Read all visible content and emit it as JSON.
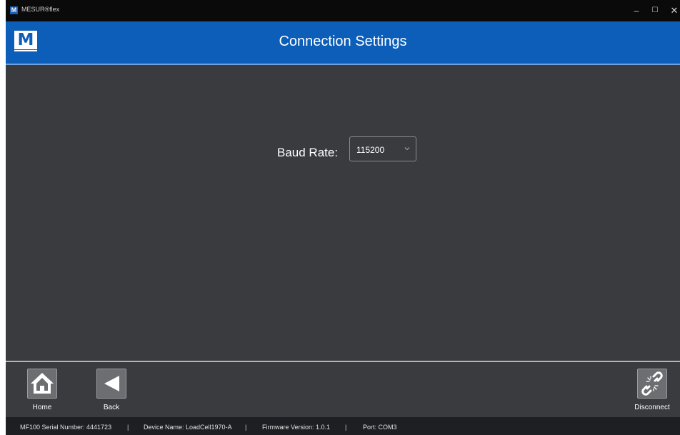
{
  "window": {
    "app_title": "MESUR®flex",
    "app_icon_letter": "M",
    "controls": {
      "minimize": "–",
      "maximize": "☐",
      "close": "✕"
    }
  },
  "header": {
    "logo_letter": "M",
    "title": "Connection Settings",
    "background_color": "#0c5eb9"
  },
  "settings": {
    "baud_rate_label": "Baud Rate:",
    "baud_rate_value": "115200"
  },
  "toolbar": {
    "home_label": "Home",
    "home_icon": "home-icon",
    "back_label": "Back",
    "back_icon": "back-arrow-icon",
    "disconnect_label": "Disconnect",
    "disconnect_icon": "broken-link-icon"
  },
  "status": {
    "serial": "MF100 Serial Number: 4441723",
    "device_name": "Device Name: LoadCell1970-A",
    "firmware": "Firmware Version: 1.0.1",
    "port": "Port: COM3",
    "separator": "|"
  }
}
